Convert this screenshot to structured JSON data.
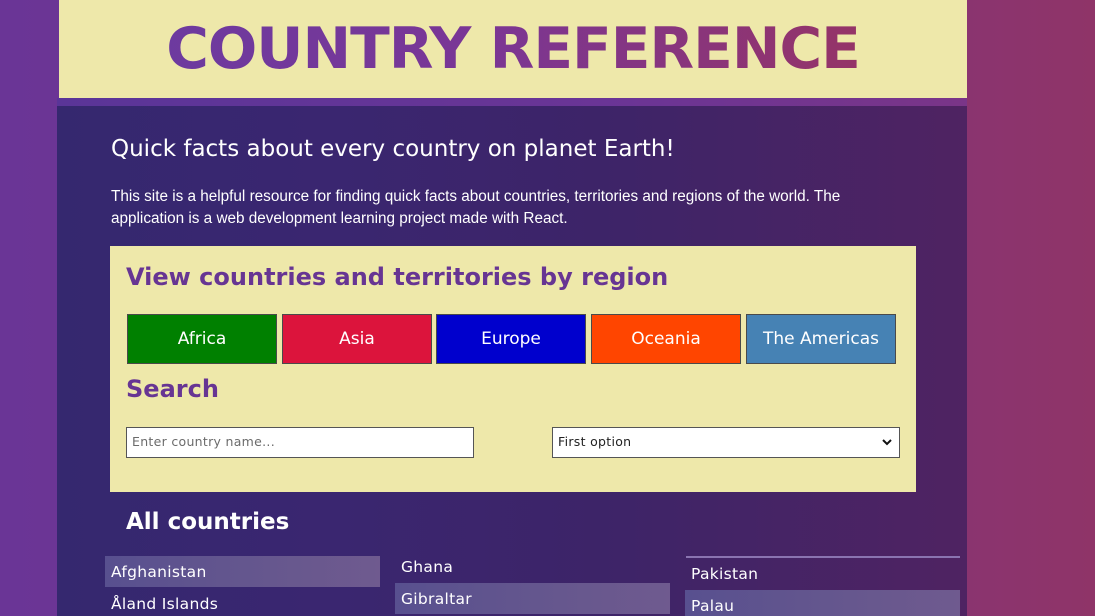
{
  "header": {
    "title": "COUNTRY REFERENCE"
  },
  "intro": {
    "tagline": "Quick facts about every country on planet Earth!",
    "description": "This site is a helpful resource for finding quick facts about countries, territories and regions of the world. The application is a web development learning project made with React."
  },
  "regions": {
    "heading": "View countries and territories by region",
    "buttons": [
      {
        "label": "Africa",
        "color": "#008000"
      },
      {
        "label": "Asia",
        "color": "#dc143c"
      },
      {
        "label": "Europe",
        "color": "#0000cd"
      },
      {
        "label": "Oceania",
        "color": "#ff4500"
      },
      {
        "label": "The Americas",
        "color": "#4682b4"
      }
    ]
  },
  "search": {
    "heading": "Search",
    "input_placeholder": "Enter country name...",
    "select_value": "First option"
  },
  "countries": {
    "heading": "All countries",
    "columns": [
      [
        "Afghanistan",
        "Åland Islands"
      ],
      [
        "Ghana",
        "Gibraltar"
      ],
      [
        "Pakistan",
        "Palau"
      ]
    ]
  },
  "colors": {
    "panel_bg": "#eee8aa",
    "accent_purple": "#673593"
  }
}
